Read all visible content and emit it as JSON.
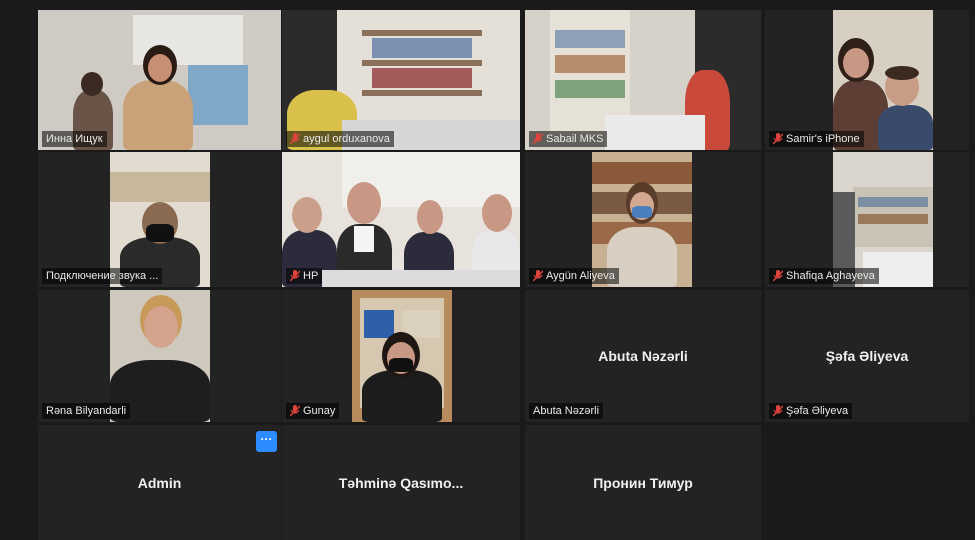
{
  "participants": [
    {
      "name": "Инна Ищук",
      "muted": false,
      "active": true
    },
    {
      "name": "aygul orduxanova",
      "muted": true
    },
    {
      "name": "Sabail MKS",
      "muted": true
    },
    {
      "name": "Samir's iPhone",
      "muted": true
    },
    {
      "name": "Подключение звука ...",
      "muted": false
    },
    {
      "name": "HP",
      "muted": true
    },
    {
      "name": "Aygün Aliyeva",
      "muted": true
    },
    {
      "name": "Shafiqa Aghayeva",
      "muted": true
    },
    {
      "name": "Rəna Bilyandarli",
      "muted": false
    },
    {
      "name": "Gunay",
      "muted": true
    },
    {
      "name": "Abuta Nəzərli",
      "muted": false,
      "display_name": "Abuta Nəzərli"
    },
    {
      "name": "Şəfa Əliyeva",
      "muted": true,
      "display_name": "Şəfa Əliyeva"
    },
    {
      "display_name": "Admin"
    },
    {
      "display_name": "Təhminə  Qasımo..."
    },
    {
      "display_name": "Пронин Тимур"
    }
  ],
  "more_button_label": "···",
  "colors": {
    "active_border": "#cfe07a",
    "accent": "#2d8cff",
    "mic_off": "#e0443c"
  }
}
